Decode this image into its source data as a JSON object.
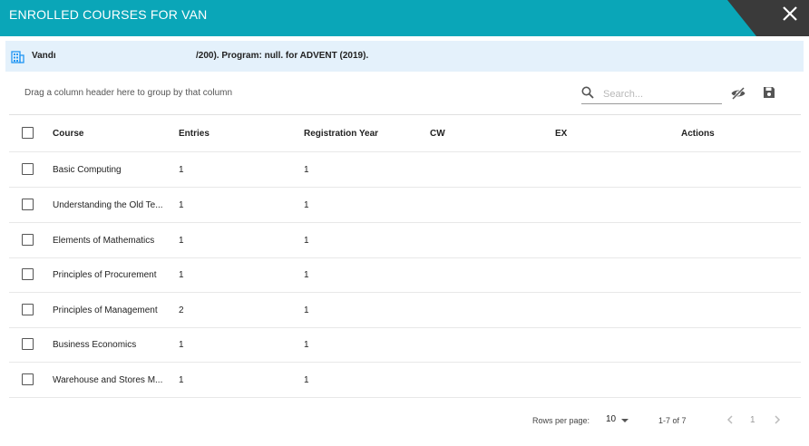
{
  "dialog": {
    "title": "ENROLLED COURSES FOR VAN"
  },
  "info": {
    "name": "Vandı",
    "details": "/200). Program: null. for ADVENT (2019)."
  },
  "toolbar": {
    "group_hint": "Drag a column header here to group by that column",
    "search_placeholder": "Search...",
    "icons": [
      "search-icon",
      "visibility-off-icon",
      "save-icon"
    ]
  },
  "table": {
    "columns": [
      "Course",
      "Entries",
      "Registration Year",
      "CW",
      "EX",
      "Actions"
    ],
    "rows": [
      {
        "course": "Basic Computing",
        "entries": "1",
        "reg_year": "1"
      },
      {
        "course": "Understanding the Old Te...",
        "entries": "1",
        "reg_year": "1"
      },
      {
        "course": "Elements of Mathematics",
        "entries": "1",
        "reg_year": "1"
      },
      {
        "course": "Principles of Procurement",
        "entries": "1",
        "reg_year": "1"
      },
      {
        "course": "Principles of Management",
        "entries": "2",
        "reg_year": "1"
      },
      {
        "course": "Business Economics",
        "entries": "1",
        "reg_year": "1"
      },
      {
        "course": "Warehouse and Stores M...",
        "entries": "1",
        "reg_year": "1"
      }
    ]
  },
  "pagination": {
    "rows_per_page_label": "Rows per page:",
    "rows_per_page": "10",
    "range": "1-7 of 7",
    "page": "1"
  },
  "colors": {
    "header": "#0aa6b8",
    "info_bg": "#e4f1fb",
    "close_wedge": "#3a3a3a"
  }
}
